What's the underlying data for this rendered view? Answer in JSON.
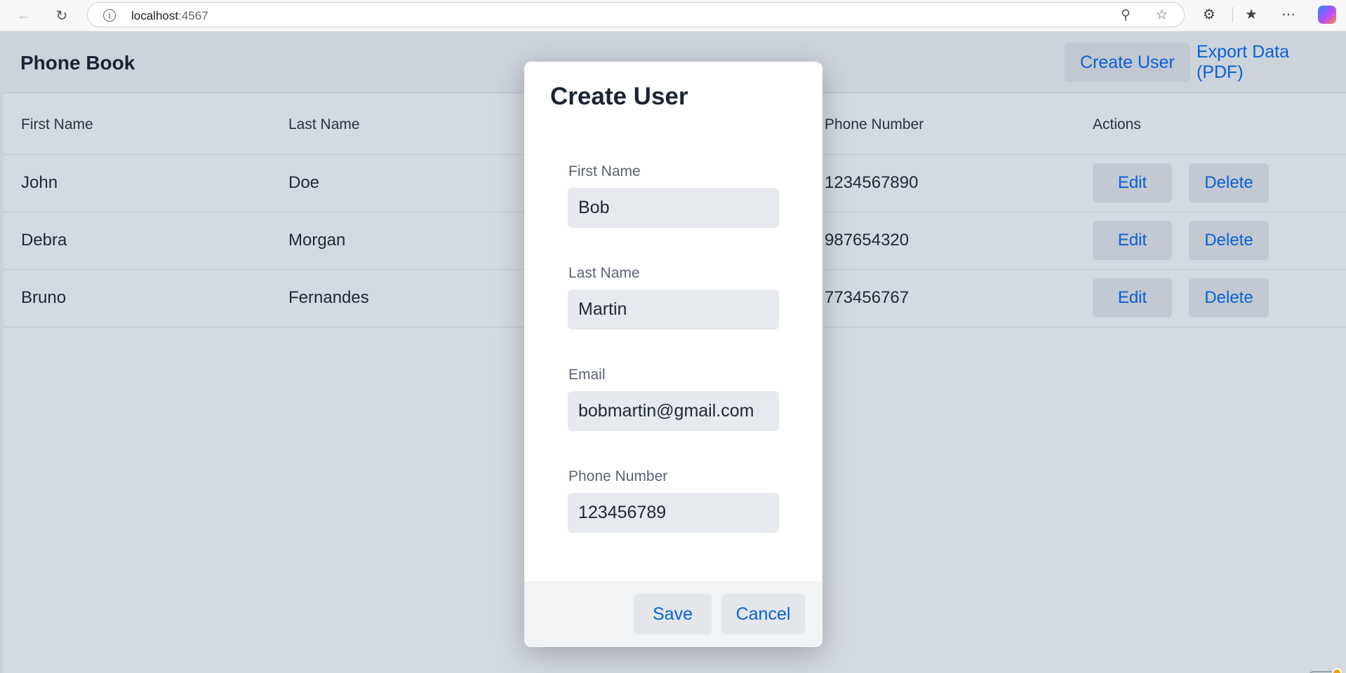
{
  "browser": {
    "url_host": "localhost",
    "url_port": ":4567",
    "icons": [
      "back-arrow-icon",
      "refresh-icon",
      "info-icon",
      "zoom-icon",
      "star-icon",
      "extensions-icon",
      "favorites-icon",
      "more-icon",
      "copilot-icon"
    ]
  },
  "header": {
    "title": "Phone Book",
    "create_user": "Create User",
    "export": "Export Data (PDF)"
  },
  "table": {
    "columns": [
      "First Name",
      "Last Name",
      "Phone Number",
      "Actions"
    ],
    "rows": [
      {
        "first": "John",
        "last": "Doe",
        "phone": "1234567890",
        "edit": "Edit",
        "delete": "Delete"
      },
      {
        "first": "Debra",
        "last": "Morgan",
        "phone": "987654320",
        "edit": "Edit",
        "delete": "Delete"
      },
      {
        "first": "Bruno",
        "last": "Fernandes",
        "phone": "773456767",
        "edit": "Edit",
        "delete": "Delete"
      }
    ]
  },
  "modal": {
    "title": "Create User",
    "fields": [
      {
        "label": "First Name",
        "value": "Bob"
      },
      {
        "label": "Last Name",
        "value": "Martin"
      },
      {
        "label": "Email",
        "value": "bobmartin@gmail.com"
      },
      {
        "label": "Phone Number",
        "value": "123456789"
      }
    ],
    "save": "Save",
    "cancel": "Cancel"
  },
  "colors": {
    "accent": "#0b5fd4",
    "overlay": "#d4dae1",
    "notification": "#f4a018"
  }
}
